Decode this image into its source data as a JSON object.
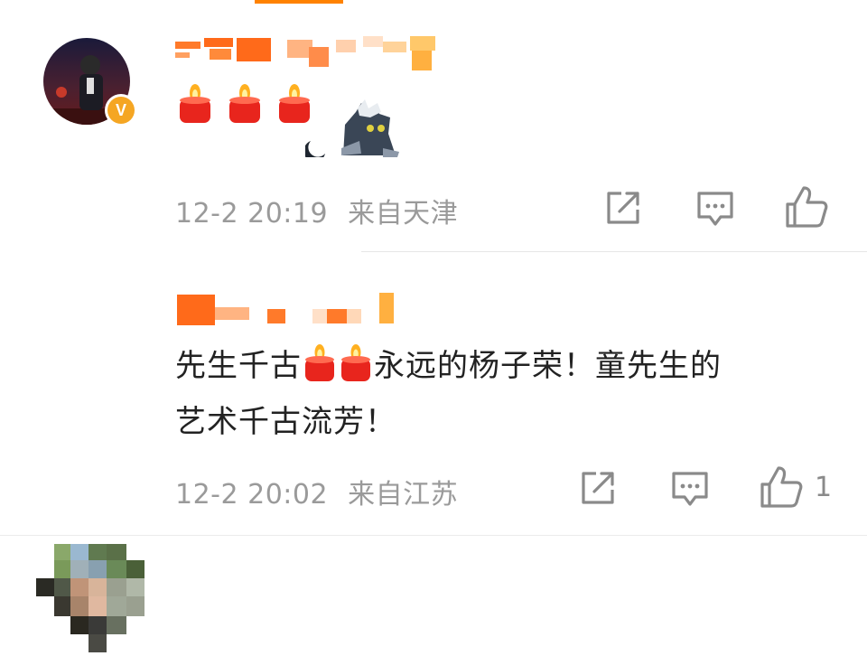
{
  "comments": [
    {
      "verified_badge": "V",
      "emoji_candles": [
        "candle-emoji",
        "candle-emoji",
        "candle-emoji"
      ],
      "sticker": "cat-sticker-icon",
      "meta": {
        "timestamp": "12-2 20:19",
        "location": "来自天津"
      },
      "actions": {
        "share": "share-icon",
        "comment": "comment-icon",
        "like": "like-icon",
        "like_count": ""
      }
    },
    {
      "content": {
        "line1_start": "先生千古",
        "line1_end": "永远的杨子荣！童先生的",
        "line2": "艺术千古流芳！"
      },
      "meta": {
        "timestamp": "12-2 20:02",
        "location": "来自江苏"
      },
      "actions": {
        "share": "share-icon",
        "comment": "comment-icon",
        "like": "like-icon",
        "like_count": "1"
      }
    }
  ],
  "colors": {
    "accent": "#ff8200",
    "verified": "#f5a623",
    "meta_gray": "#9a9a9a",
    "text": "#222222",
    "candle_red": "#e8251d"
  }
}
